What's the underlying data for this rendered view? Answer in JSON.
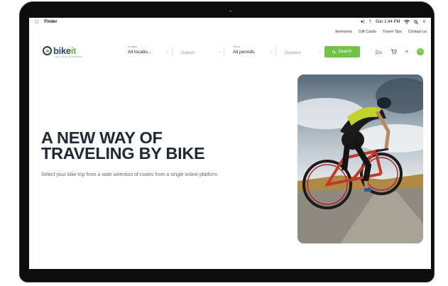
{
  "menubar": {
    "app": "Finder",
    "time": "Sun 1:44 PM"
  },
  "toplinks": [
    "Itineraries",
    "Gift Cards",
    "Travel Tips",
    "Contact us"
  ],
  "logo": {
    "name_a": "bike",
    "name_b": "it",
    "tagline": "THE CYCLING EXPERIENCE"
  },
  "search": {
    "location": {
      "label": "Location",
      "value": "All locatio..."
    },
    "guests": {
      "value": "Guests"
    },
    "period": {
      "label": "Period",
      "value": "All periods"
    },
    "duration": {
      "value": "Duration"
    },
    "button": "Search"
  },
  "hero": {
    "title_line1": "A NEW WAY OF",
    "title_line2": "TRAVELING BY BIKE",
    "subtitle": "Select your bike trip from a wide selection of routes from a single online platform"
  },
  "colors": {
    "accent": "#72c245",
    "navy": "#1d2a36"
  },
  "icons": [
    "apple-icon",
    "volume-icon",
    "wifi-icon",
    "search-icon",
    "translate-icon",
    "cart-icon",
    "menu-icon",
    "user-icon"
  ]
}
